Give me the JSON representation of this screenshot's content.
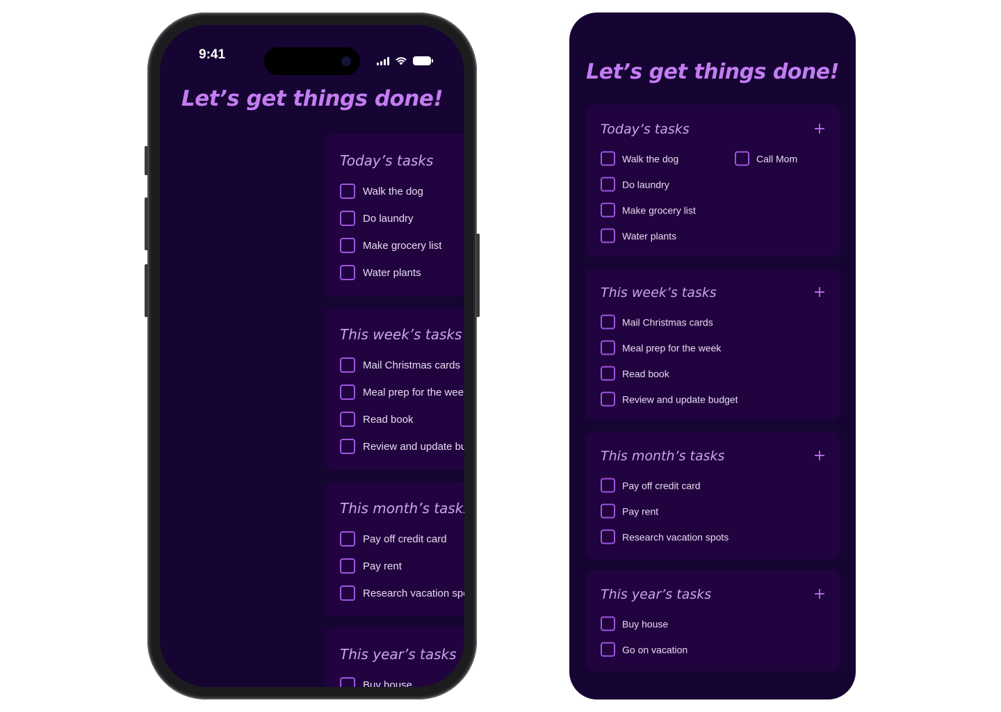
{
  "phone": {
    "status_bar": {
      "time": "9:41"
    }
  },
  "app": {
    "title": "Let’s get things done!",
    "accent_color": "#c37cf2",
    "background_color": "#160433",
    "card_color": "#21043f",
    "add_icon": "plus-icon",
    "sections": [
      {
        "title": "Today’s tasks",
        "tasks": [
          "Walk the dog",
          "Call Mom",
          "Do laundry",
          "Make grocery list",
          "Water plants"
        ],
        "checked": [
          false,
          false,
          false,
          false,
          false
        ]
      },
      {
        "title": "This week’s tasks",
        "tasks": [
          "Mail Christmas cards",
          "Meal prep for the week",
          "Read book",
          "Review and update budget"
        ],
        "checked": [
          false,
          false,
          false,
          false
        ]
      },
      {
        "title": "This month’s tasks",
        "tasks": [
          "Pay off credit card",
          "Pay rent",
          "Research vacation spots"
        ],
        "checked": [
          false,
          false,
          false
        ]
      },
      {
        "title": "This year’s tasks",
        "tasks": [
          "Buy house",
          "Go on vacation"
        ],
        "checked": [
          false,
          false
        ]
      }
    ]
  }
}
